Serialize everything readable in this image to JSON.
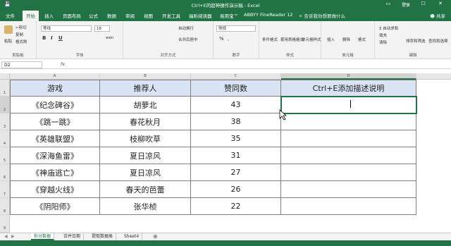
{
  "titlebar": {
    "title": "Ctrl+E的超神操作演示稿 - Excel",
    "login": "登录",
    "save_icon": "save-icon",
    "window_controls": "▭ — ☐ ✕"
  },
  "ribbon_tabs": [
    "文件",
    "开始",
    "插入",
    "页面布局",
    "公式",
    "数据",
    "审阅",
    "视图",
    "开发工具",
    "福昕阅读器",
    "易用宝™",
    "ABBYY FineReader 12"
  ],
  "active_tab": "开始",
  "tellme": "告诉我你想要做什么",
  "share": "共享",
  "ribbon": {
    "clipboard": {
      "label": "剪贴板",
      "paste": "粘贴",
      "cut": "剪切",
      "copy": "复制",
      "format_painter": "格式刷"
    },
    "font": {
      "label": "字体",
      "font_name": "等线",
      "font_size": "18",
      "bold": "B",
      "italic": "I",
      "underline": "U",
      "wen": "wén"
    },
    "alignment": {
      "label": "对齐方式",
      "wrap": "自动换行",
      "merge": "合并后居中"
    },
    "number": {
      "label": "数字",
      "format": "常规",
      "percent": "%",
      "comma": ","
    },
    "styles": {
      "label": "样式",
      "conditional": "条件格式",
      "table": "套用表格格式",
      "cell_style": "单元格样式"
    },
    "cells": {
      "label": "单元格",
      "insert": "插入",
      "delete": "删除",
      "format": "格式"
    },
    "editing": {
      "label": "编辑",
      "autosum": "自动求和",
      "fill": "填充",
      "clear": "清除",
      "sort": "排序和筛选",
      "find": "查找和选择"
    }
  },
  "formula_bar": {
    "name_box": "D2",
    "fx": "fx",
    "value": ""
  },
  "columns": [
    "A",
    "B",
    "C",
    "D"
  ],
  "rows": [
    "1",
    "2",
    "3",
    "4",
    "5",
    "6",
    "7",
    "8",
    "9"
  ],
  "table": {
    "headers": [
      "游戏",
      "推荐人",
      "赞同数",
      "Ctrl+E添加描述说明"
    ],
    "rows": [
      [
        "《纪念碑谷》",
        "胡萝北",
        "43",
        ""
      ],
      [
        "《跳一跳》",
        "春花秋月",
        "38",
        ""
      ],
      [
        "《英雄联盟》",
        "枝柳吹草",
        "35",
        ""
      ],
      [
        "《深海鱼雷》",
        "夏日凉风",
        "31",
        ""
      ],
      [
        "《神庙逃亡》",
        "夏日凉风",
        "27",
        ""
      ],
      [
        "《穿越火线》",
        "春天的芭蕾",
        "26",
        ""
      ],
      [
        "《阴阳师》",
        "张华桢",
        "22",
        ""
      ]
    ]
  },
  "sheets": [
    "拆分数据",
    "合并日期",
    "提取数据类",
    "Sheet4"
  ],
  "active_sheet": "拆分数据",
  "status": {
    "ready": "",
    "zoom": ""
  },
  "colors": {
    "brand": "#217346",
    "header_fill": "#dae3f3"
  }
}
